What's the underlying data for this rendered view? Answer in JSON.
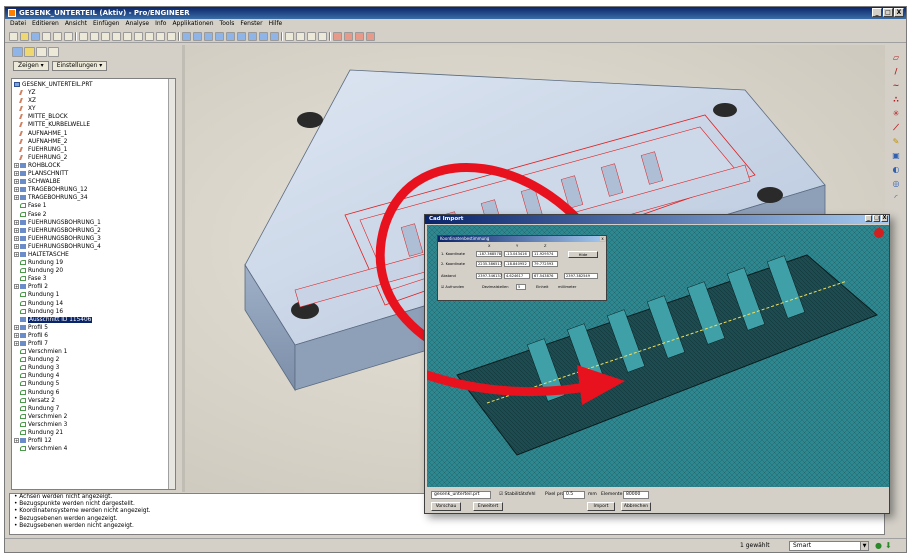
{
  "window": {
    "title": "GESENK_UNTERTEIL (Aktiv) - Pro/ENGINEER",
    "controls": [
      "_",
      "□",
      "X"
    ]
  },
  "menu": [
    "Datei",
    "Editieren",
    "Ansicht",
    "Einfügen",
    "Analyse",
    "Info",
    "Applikationen",
    "Tools",
    "Fenster",
    "Hilfe"
  ],
  "panel": {
    "show_label": "Zeigen ▾",
    "settings_label": "Einstellungen ▾"
  },
  "tree": [
    {
      "label": "GESENK_UNTERTEIL.PRT",
      "icon": "part-icon",
      "plus": false,
      "indent": 0
    },
    {
      "label": "YZ",
      "icon": "datum-plane-icon",
      "plus": false,
      "indent": 1
    },
    {
      "label": "XZ",
      "icon": "datum-plane-icon",
      "plus": false,
      "indent": 1
    },
    {
      "label": "XY",
      "icon": "datum-plane-icon",
      "plus": false,
      "indent": 1
    },
    {
      "label": "MITTE_BLOCK",
      "icon": "datum-plane-icon",
      "plus": false,
      "indent": 1
    },
    {
      "label": "MITTE_KURBELWELLE",
      "icon": "datum-plane-icon",
      "plus": false,
      "indent": 1
    },
    {
      "label": "AUFNAHME_1",
      "icon": "datum-plane-icon",
      "plus": false,
      "indent": 1
    },
    {
      "label": "AUFNAHME_2",
      "icon": "datum-plane-icon",
      "plus": false,
      "indent": 1
    },
    {
      "label": "FUEHRUNG_1",
      "icon": "datum-plane-icon",
      "plus": false,
      "indent": 1
    },
    {
      "label": "FUEHRUNG_2",
      "icon": "datum-plane-icon",
      "plus": false,
      "indent": 1
    },
    {
      "label": "ROHBLOCK",
      "icon": "feature-icon",
      "plus": true,
      "indent": 0
    },
    {
      "label": "PLANSCHNITT",
      "icon": "feature-icon",
      "plus": true,
      "indent": 0
    },
    {
      "label": "SCHWALBE",
      "icon": "feature-icon",
      "plus": true,
      "indent": 0
    },
    {
      "label": "TRAGEBOHRUNG_12",
      "icon": "feature-icon",
      "plus": true,
      "indent": 0
    },
    {
      "label": "TRAGEBOHRUNG_34",
      "icon": "feature-icon",
      "plus": true,
      "indent": 0
    },
    {
      "label": "Fase 1",
      "icon": "round-icon",
      "plus": false,
      "indent": 1
    },
    {
      "label": "Fase 2",
      "icon": "round-icon",
      "plus": false,
      "indent": 1
    },
    {
      "label": "FUEHRUNGSBOHRUNG_1",
      "icon": "feature-icon",
      "plus": true,
      "indent": 0
    },
    {
      "label": "FUEHRUNGSBOHRUNG_2",
      "icon": "feature-icon",
      "plus": true,
      "indent": 0
    },
    {
      "label": "FUEHRUNGSBOHRUNG_3",
      "icon": "feature-icon",
      "plus": true,
      "indent": 0
    },
    {
      "label": "FUEHRUNGSBOHRUNG_4",
      "icon": "feature-icon",
      "plus": true,
      "indent": 0
    },
    {
      "label": "HALTETASCHE",
      "icon": "feature-icon",
      "plus": true,
      "indent": 0
    },
    {
      "label": "Rundung 19",
      "icon": "round-icon",
      "plus": false,
      "indent": 1
    },
    {
      "label": "Rundung 20",
      "icon": "round-icon",
      "plus": false,
      "indent": 1
    },
    {
      "label": "Fase 3",
      "icon": "round-icon",
      "plus": false,
      "indent": 1
    },
    {
      "label": "Profil 2",
      "icon": "feature-icon",
      "plus": true,
      "indent": 0
    },
    {
      "label": "Rundung 1",
      "icon": "round-icon",
      "plus": false,
      "indent": 1
    },
    {
      "label": "Rundung 14",
      "icon": "round-icon",
      "plus": false,
      "indent": 1
    },
    {
      "label": "Rundung 16",
      "icon": "round-icon",
      "plus": false,
      "indent": 1
    },
    {
      "label": "Ausschnitt ID 115406",
      "icon": "feature-icon",
      "plus": false,
      "indent": 1,
      "selected": true
    },
    {
      "label": "Profil 5",
      "icon": "feature-icon",
      "plus": true,
      "indent": 0
    },
    {
      "label": "Profil 6",
      "icon": "feature-icon",
      "plus": true,
      "indent": 0
    },
    {
      "label": "Profil 7",
      "icon": "feature-icon",
      "plus": true,
      "indent": 0
    },
    {
      "label": "Verschmien 1",
      "icon": "round-icon",
      "plus": false,
      "indent": 1
    },
    {
      "label": "Rundung 2",
      "icon": "round-icon",
      "plus": false,
      "indent": 1
    },
    {
      "label": "Rundung 3",
      "icon": "round-icon",
      "plus": false,
      "indent": 1
    },
    {
      "label": "Rundung 4",
      "icon": "round-icon",
      "plus": false,
      "indent": 1
    },
    {
      "label": "Rundung 5",
      "icon": "round-icon",
      "plus": false,
      "indent": 1
    },
    {
      "label": "Rundung 6",
      "icon": "round-icon",
      "plus": false,
      "indent": 1
    },
    {
      "label": "Versatz 2",
      "icon": "round-icon",
      "plus": false,
      "indent": 1
    },
    {
      "label": "Rundung 7",
      "icon": "round-icon",
      "plus": false,
      "indent": 1
    },
    {
      "label": "Verschmien 2",
      "icon": "round-icon",
      "plus": false,
      "indent": 1
    },
    {
      "label": "Verschmien 3",
      "icon": "round-icon",
      "plus": false,
      "indent": 1
    },
    {
      "label": "Rundung 21",
      "icon": "round-icon",
      "plus": false,
      "indent": 1
    },
    {
      "label": "Profil 12",
      "icon": "feature-icon",
      "plus": true,
      "indent": 0
    },
    {
      "label": "Verschmien 4",
      "icon": "round-icon",
      "plus": false,
      "indent": 1
    }
  ],
  "messages": [
    "• Achsen werden nicht angezeigt.",
    "• Bezugspunkte werden nicht dargestellt.",
    "• Koordinatensysteme werden nicht angezeigt.",
    "• Bezugsebenen werden angezeigt.",
    "• Bezugsebenen werden nicht angezeigt."
  ],
  "status": {
    "selected_count": "1 gewählt",
    "filter": "Smart"
  },
  "cad_window": {
    "title": "Cad Import",
    "file_select": "gesenk_unterteil.prt",
    "checkbox_label": "Stabilitätsfehl",
    "pixel_label": "Pixel pro",
    "pixel_value": "0.5",
    "unit_label": "mm",
    "elements_label": "Elemente",
    "elements_value": "80000",
    "btn_vorschau": "Vorschau",
    "btn_erweitert": "Erweitert",
    "btn_import": "Import",
    "btn_abbrechen": "Abbrechen"
  },
  "coord_dialog": {
    "title": "Koordinatenbestimmung",
    "headers": [
      "X",
      "Y",
      "Z"
    ],
    "row1_label": "1. Koordinate",
    "row1": [
      "-187.368578",
      "-13.043416",
      "11.929574"
    ],
    "row2_label": "2. Koordinate",
    "row2": [
      "2235.386517",
      "-18.840952",
      "79.772593"
    ],
    "row3_label": "Abstand",
    "row3": [
      "2397.346137",
      "4.624617",
      "67.543876"
    ],
    "total_value": "2397.382549",
    "btn_hide": "Hide",
    "checkbox_label": "Aufrunden",
    "decimals_label": "Dezimalstellen",
    "decimals_value": "5",
    "unit_label": "Einheit",
    "unit_value": "millimeter"
  }
}
